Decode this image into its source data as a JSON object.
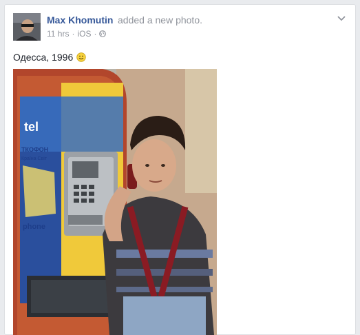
{
  "post": {
    "author": "Max Khomutin",
    "action": "added a new photo.",
    "time": "11 hrs",
    "separator": "·",
    "source": "iOS",
    "privacy_icon": "globe-icon",
    "menu_icon": "chevron-down-icon",
    "text": "Одесса, 1996",
    "emoji_icon": "smiley-icon"
  },
  "photo": {
    "booth_sign_brand": "tel",
    "booth_sign_middle": "ТКОФОН",
    "booth_sign_sub": "Країна Світ",
    "booth_sign_bottom": "phone"
  },
  "colors": {
    "link": "#365899",
    "meta": "#90949c",
    "text": "#1d2129",
    "page_bg": "#e9ebee"
  }
}
